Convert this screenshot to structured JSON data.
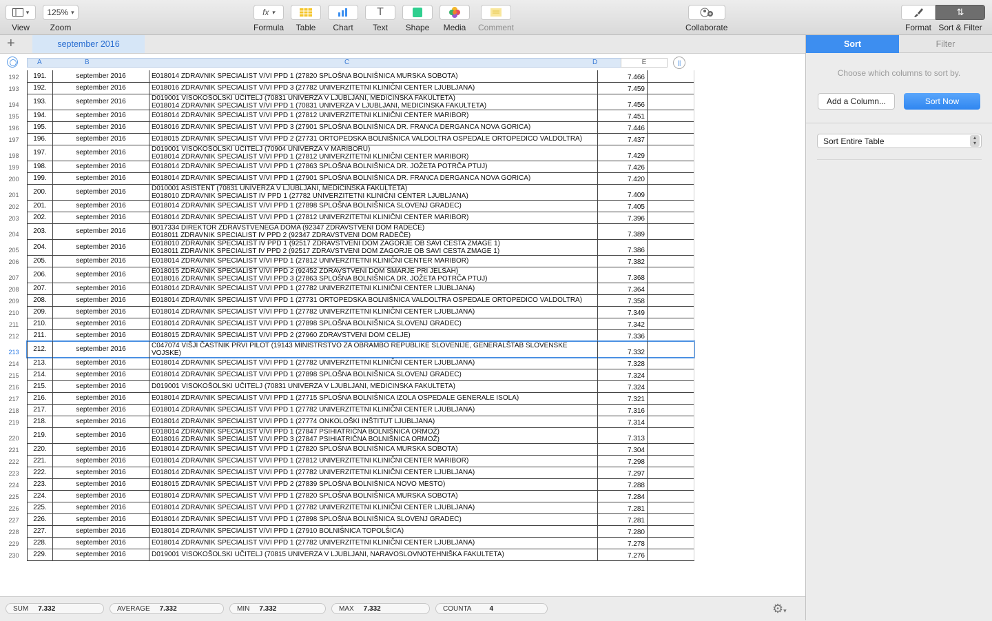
{
  "toolbar": {
    "view_label": "View",
    "zoom_value": "125%",
    "zoom_label": "Zoom",
    "formula_label": "Formula",
    "formula_glyph": "fx",
    "table_label": "Table",
    "chart_label": "Chart",
    "text_label": "Text",
    "text_glyph": "T",
    "shape_label": "Shape",
    "media_label": "Media",
    "comment_label": "Comment",
    "collaborate_label": "Collaborate",
    "format_label": "Format",
    "sort_filter_label": "Sort & Filter"
  },
  "sheet": {
    "add_symbol": "+",
    "tab_name": "september 2016"
  },
  "columns": [
    "A",
    "B",
    "C",
    "D",
    "E"
  ],
  "rows": [
    {
      "n": "192",
      "a": "191.",
      "b": "september 2016",
      "c": [
        "E018014 ZDRAVNIK SPECIALIST V/VI PPD 1 (27820 SPLOŠNA BOLNIŠNICA MURSKA SOBOTA)"
      ],
      "d": "7.466"
    },
    {
      "n": "193",
      "a": "192.",
      "b": "september 2016",
      "c": [
        "E018016 ZDRAVNIK SPECIALIST V/VI PPD 3 (27782 UNIVERZITETNI KLINIČNI CENTER LJUBLJANA)"
      ],
      "d": "7.459"
    },
    {
      "n": "194",
      "a": "193.",
      "b": "september 2016",
      "c": [
        "D019001 VISOKOŠOLSKI UČITELJ (70831 UNIVERZA V LJUBLJANI, MEDICINSKA FAKULTETA)",
        "E018014 ZDRAVNIK SPECIALIST V/VI PPD 1 (70831 UNIVERZA V LJUBLJANI, MEDICINSKA FAKULTETA)"
      ],
      "d": "7.456"
    },
    {
      "n": "195",
      "a": "194.",
      "b": "september 2016",
      "c": [
        "E018014 ZDRAVNIK SPECIALIST V/VI PPD 1 (27812 UNIVERZITETNI KLINIČNI CENTER MARIBOR)"
      ],
      "d": "7.451"
    },
    {
      "n": "196",
      "a": "195.",
      "b": "september 2016",
      "c": [
        "E018016 ZDRAVNIK SPECIALIST V/VI PPD 3 (27901 SPLOŠNA BOLNIŠNICA DR. FRANCA DERGANCA NOVA GORICA)"
      ],
      "d": "7.446"
    },
    {
      "n": "197",
      "a": "196.",
      "b": "september 2016",
      "c": [
        "E018015 ZDRAVNIK SPECIALIST V/VI PPD 2 (27731 ORTOPEDSKA BOLNIŠNICA VALDOLTRA OSPEDALE ORTOPEDICO VALDOLTRA)"
      ],
      "d": "7.437"
    },
    {
      "n": "198",
      "a": "197.",
      "b": "september 2016",
      "c": [
        "D019001 VISOKOŠOLSKI UČITELJ (70904 UNIVERZA V MARIBORU)",
        "E018014 ZDRAVNIK SPECIALIST V/VI PPD 1 (27812 UNIVERZITETNI KLINIČNI CENTER MARIBOR)"
      ],
      "d": "7.429"
    },
    {
      "n": "199",
      "a": "198.",
      "b": "september 2016",
      "c": [
        "E018014 ZDRAVNIK SPECIALIST V/VI PPD 1 (27863 SPLOŠNA BOLNIŠNICA DR. JOŽETA POTRČA PTUJ)"
      ],
      "d": "7.426"
    },
    {
      "n": "200",
      "a": "199.",
      "b": "september 2016",
      "c": [
        "E018014 ZDRAVNIK SPECIALIST V/VI PPD 1 (27901 SPLOŠNA BOLNIŠNICA DR. FRANCA DERGANCA NOVA GORICA)"
      ],
      "d": "7.420"
    },
    {
      "n": "201",
      "a": "200.",
      "b": "september 2016",
      "c": [
        "D010001 ASISTENT (70831 UNIVERZA V LJUBLJANI, MEDICINSKA FAKULTETA)",
        "E018010 ZDRAVNIK SPECIALIST IV PPD 1 (27782 UNIVERZITETNI KLINIČNI CENTER LJUBLJANA)"
      ],
      "d": "7.409"
    },
    {
      "n": "202",
      "a": "201.",
      "b": "september 2016",
      "c": [
        "E018014 ZDRAVNIK SPECIALIST V/VI PPD 1 (27898 SPLOŠNA BOLNIŠNICA SLOVENJ GRADEC)"
      ],
      "d": "7.405"
    },
    {
      "n": "203",
      "a": "202.",
      "b": "september 2016",
      "c": [
        "E018014 ZDRAVNIK SPECIALIST V/VI PPD 1 (27812 UNIVERZITETNI KLINIČNI CENTER MARIBOR)"
      ],
      "d": "7.396"
    },
    {
      "n": "204",
      "a": "203.",
      "b": "september 2016",
      "c": [
        "B017334 DIREKTOR ZDRAVSTVENEGA DOMA (92347 ZDRAVSTVENI DOM RADEČE)",
        "E018011 ZDRAVNIK SPECIALIST IV PPD 2 (92347 ZDRAVSTVENI DOM RADEČE)"
      ],
      "d": "7.389"
    },
    {
      "n": "205",
      "a": "204.",
      "b": "september 2016",
      "c": [
        "E018010 ZDRAVNIK SPECIALIST IV PPD 1 (92517 ZDRAVSTVENI DOM ZAGORJE OB SAVI CESTA ZMAGE 1)",
        "E018011 ZDRAVNIK SPECIALIST IV PPD 2 (92517 ZDRAVSTVENI DOM ZAGORJE OB SAVI CESTA ZMAGE 1)"
      ],
      "d": "7.386"
    },
    {
      "n": "206",
      "a": "205.",
      "b": "september 2016",
      "c": [
        "E018014 ZDRAVNIK SPECIALIST V/VI PPD 1 (27812 UNIVERZITETNI KLINIČNI CENTER MARIBOR)"
      ],
      "d": "7.382"
    },
    {
      "n": "207",
      "a": "206.",
      "b": "september 2016",
      "c": [
        "E018015 ZDRAVNIK SPECIALIST V/VI PPD 2 (92452 ZDRAVSTVENI DOM ŠMARJE PRI JELŠAH)",
        "E018016 ZDRAVNIK SPECIALIST V/VI PPD 3 (27863 SPLOŠNA BOLNIŠNICA DR. JOŽETA POTRČA PTUJ)"
      ],
      "d": "7.368"
    },
    {
      "n": "208",
      "a": "207.",
      "b": "september 2016",
      "c": [
        "E018014 ZDRAVNIK SPECIALIST V/VI PPD 1 (27782 UNIVERZITETNI KLINIČNI CENTER LJUBLJANA)"
      ],
      "d": "7.364"
    },
    {
      "n": "209",
      "a": "208.",
      "b": "september 2016",
      "c": [
        "E018014 ZDRAVNIK SPECIALIST V/VI PPD 1 (27731 ORTOPEDSKA BOLNIŠNICA VALDOLTRA OSPEDALE ORTOPEDICO VALDOLTRA)"
      ],
      "d": "7.358"
    },
    {
      "n": "210",
      "a": "209.",
      "b": "september 2016",
      "c": [
        "E018014 ZDRAVNIK SPECIALIST V/VI PPD 1 (27782 UNIVERZITETNI KLINIČNI CENTER LJUBLJANA)"
      ],
      "d": "7.349"
    },
    {
      "n": "211",
      "a": "210.",
      "b": "september 2016",
      "c": [
        "E018014 ZDRAVNIK SPECIALIST V/VI PPD 1 (27898 SPLOŠNA BOLNIŠNICA SLOVENJ GRADEC)"
      ],
      "d": "7.342"
    },
    {
      "n": "212",
      "a": "211.",
      "b": "september 2016",
      "c": [
        "E018015 ZDRAVNIK SPECIALIST V/VI PPD 2 (27960 ZDRAVSTVENI DOM CELJE)"
      ],
      "d": "7.336"
    },
    {
      "n": "213",
      "a": "212.",
      "b": "september 2016",
      "c": [
        "C047074 VIŠJI ČASTNIK PRVI PILOT (19143 MINISTRSTVO ZA OBRAMBO REPUBLIKE SLOVENIJE, GENERALŠTAB SLOVENSKE",
        "VOJSKE)"
      ],
      "d": "7.332",
      "selected": true
    },
    {
      "n": "214",
      "a": "213.",
      "b": "september 2016",
      "c": [
        "E018014 ZDRAVNIK SPECIALIST V/VI PPD 1 (27782 UNIVERZITETNI KLINIČNI CENTER LJUBLJANA)"
      ],
      "d": "7.328"
    },
    {
      "n": "215",
      "a": "214.",
      "b": "september 2016",
      "c": [
        "E018014 ZDRAVNIK SPECIALIST V/VI PPD 1 (27898 SPLOŠNA BOLNIŠNICA SLOVENJ GRADEC)"
      ],
      "d": "7.324"
    },
    {
      "n": "216",
      "a": "215.",
      "b": "september 2016",
      "c": [
        "D019001 VISOKOŠOLSKI UČITELJ (70831 UNIVERZA V LJUBLJANI, MEDICINSKA FAKULTETA)"
      ],
      "d": "7.324"
    },
    {
      "n": "217",
      "a": "216.",
      "b": "september 2016",
      "c": [
        "E018014 ZDRAVNIK SPECIALIST V/VI PPD 1 (27715 SPLOŠNA BOLNIŠNICA IZOLA OSPEDALE GENERALE ISOLA)"
      ],
      "d": "7.321"
    },
    {
      "n": "218",
      "a": "217.",
      "b": "september 2016",
      "c": [
        "E018014 ZDRAVNIK SPECIALIST V/VI PPD 1 (27782 UNIVERZITETNI KLINIČNI CENTER LJUBLJANA)"
      ],
      "d": "7.316"
    },
    {
      "n": "219",
      "a": "218.",
      "b": "september 2016",
      "c": [
        "E018014 ZDRAVNIK SPECIALIST V/VI PPD 1 (27774 ONKOLOŠKI INŠTITUT LJUBLJANA)"
      ],
      "d": "7.314"
    },
    {
      "n": "220",
      "a": "219.",
      "b": "september 2016",
      "c": [
        "E018014 ZDRAVNIK SPECIALIST V/VI PPD 1 (27847 PSIHIATRIČNA BOLNIŠNICA ORMOŽ)",
        "E018016 ZDRAVNIK SPECIALIST V/VI PPD 3 (27847 PSIHIATRIČNA BOLNIŠNICA ORMOŽ)"
      ],
      "d": "7.313"
    },
    {
      "n": "221",
      "a": "220.",
      "b": "september 2016",
      "c": [
        "E018014 ZDRAVNIK SPECIALIST V/VI PPD 1 (27820 SPLOŠNA BOLNIŠNICA MURSKA SOBOTA)"
      ],
      "d": "7.304"
    },
    {
      "n": "222",
      "a": "221.",
      "b": "september 2016",
      "c": [
        "E018014 ZDRAVNIK SPECIALIST V/VI PPD 1 (27812 UNIVERZITETNI KLINIČNI CENTER MARIBOR)"
      ],
      "d": "7.298"
    },
    {
      "n": "223",
      "a": "222.",
      "b": "september 2016",
      "c": [
        "E018014 ZDRAVNIK SPECIALIST V/VI PPD 1 (27782 UNIVERZITETNI KLINIČNI CENTER LJUBLJANA)"
      ],
      "d": "7.297"
    },
    {
      "n": "224",
      "a": "223.",
      "b": "september 2016",
      "c": [
        "E018015 ZDRAVNIK SPECIALIST V/VI PPD 2 (27839 SPLOŠNA BOLNIŠNICA NOVO MESTO)"
      ],
      "d": "7.288"
    },
    {
      "n": "225",
      "a": "224.",
      "b": "september 2016",
      "c": [
        "E018014 ZDRAVNIK SPECIALIST V/VI PPD 1 (27820 SPLOŠNA BOLNIŠNICA MURSKA SOBOTA)"
      ],
      "d": "7.284"
    },
    {
      "n": "226",
      "a": "225.",
      "b": "september 2016",
      "c": [
        "E018014 ZDRAVNIK SPECIALIST V/VI PPD 1 (27782 UNIVERZITETNI KLINIČNI CENTER LJUBLJANA)"
      ],
      "d": "7.281"
    },
    {
      "n": "227",
      "a": "226.",
      "b": "september 2016",
      "c": [
        "E018014 ZDRAVNIK SPECIALIST V/VI PPD 1 (27898 SPLOŠNA BOLNIŠNICA SLOVENJ GRADEC)"
      ],
      "d": "7.281"
    },
    {
      "n": "228",
      "a": "227.",
      "b": "september 2016",
      "c": [
        "E018014 ZDRAVNIK SPECIALIST V/VI PPD 1 (27910 BOLNIŠNICA TOPOLŠICA)"
      ],
      "d": "7.280"
    },
    {
      "n": "229",
      "a": "228.",
      "b": "september 2016",
      "c": [
        "E018014 ZDRAVNIK SPECIALIST V/VI PPD 1 (27782 UNIVERZITETNI KLINIČNI CENTER LJUBLJANA)"
      ],
      "d": "7.278"
    },
    {
      "n": "230",
      "a": "229.",
      "b": "september 2016",
      "c": [
        "D019001 VISOKOŠOLSKI UČITELJ (70815 UNIVERZA V LJUBLJANI, NARAVOSLOVNOTEHNIŠKA FAKULTETA)"
      ],
      "d": "7.276"
    }
  ],
  "statusbar": [
    {
      "label": "SUM",
      "value": "7.332"
    },
    {
      "label": "AVERAGE",
      "value": "7.332"
    },
    {
      "label": "MIN",
      "value": "7.332"
    },
    {
      "label": "MAX",
      "value": "7.332"
    },
    {
      "label": "COUNTA",
      "value": "4"
    }
  ],
  "sidebar": {
    "tab_sort": "Sort",
    "tab_filter": "Filter",
    "hint": "Choose which columns to sort by.",
    "add_column": "Add a Column...",
    "sort_now": "Sort Now",
    "scope_value": "Sort Entire Table"
  },
  "colors": {
    "accent": "#3d8ef0",
    "selection": "#4a90e2"
  }
}
